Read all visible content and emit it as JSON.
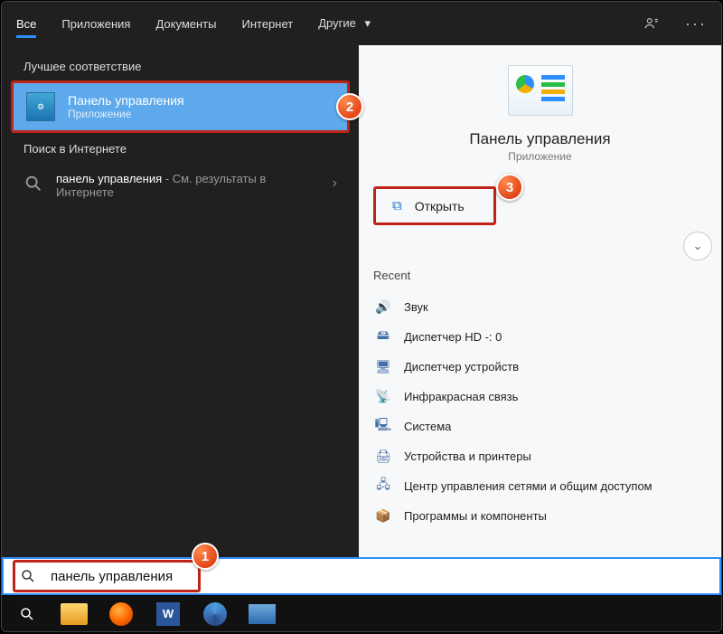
{
  "tabs": {
    "items": [
      "Все",
      "Приложения",
      "Документы",
      "Интернет",
      "Другие"
    ],
    "active_index": 0
  },
  "sections": {
    "best_match": "Лучшее соответствие",
    "web": "Поиск в Интернете"
  },
  "best_result": {
    "title": "Панель управления",
    "subtitle": "Приложение"
  },
  "web_result": {
    "query": "панель управления",
    "hint": " - См. результаты в Интернете"
  },
  "preview": {
    "title": "Панель управления",
    "subtitle": "Приложение",
    "open_label": "Открыть",
    "recent_label": "Recent",
    "recent": [
      "Звук",
      "Диспетчер HD -: 0",
      "Диспетчер устройств",
      "Инфракрасная связь",
      "Система",
      "Устройства и принтеры",
      "Центр управления сетями и общим доступом",
      "Программы и компоненты"
    ]
  },
  "search": {
    "value": "панель управления"
  },
  "callouts": {
    "one": "1",
    "two": "2",
    "three": "3"
  }
}
